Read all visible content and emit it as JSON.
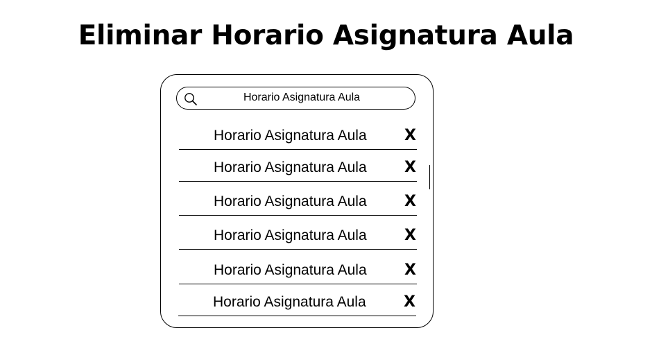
{
  "page": {
    "title": "Eliminar Horario Asignatura Aula"
  },
  "search": {
    "value": "Horario Asignatura Aula",
    "icon": "search-icon"
  },
  "list": {
    "delete_label": "X",
    "items": [
      {
        "label": "Horario Asignatura Aula"
      },
      {
        "label": "Horario Asignatura Aula"
      },
      {
        "label": "Horario Asignatura Aula"
      },
      {
        "label": "Horario Asignatura Aula"
      },
      {
        "label": "Horario Asignatura Aula"
      },
      {
        "label": "Horario Asignatura Aula"
      }
    ]
  },
  "colors": {
    "foreground": "#000000",
    "background": "#ffffff"
  }
}
